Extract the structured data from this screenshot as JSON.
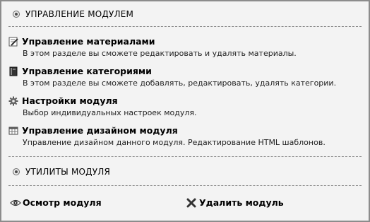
{
  "modules_section": {
    "header": "УПРАВЛЕНИЕ МОДУЛЕМ",
    "items": [
      {
        "title": "Управление материалами",
        "description": "В этом разделе вы сможете редактировать и удалять материалы.",
        "icon": "edit-document-icon"
      },
      {
        "title": "Управление категориями",
        "description": "В этом разделе вы сможете добавлять, редактировать, удалять категории.",
        "icon": "book-icon"
      },
      {
        "title": "Настройки модуля",
        "description": "Выбор индивидуальных настроек модуля.",
        "icon": "gear-icon"
      },
      {
        "title": "Управление дизайном модуля",
        "description": "Управление дизайном данного модуля. Редактирование HTML шаблонов.",
        "icon": "layout-grid-icon"
      }
    ]
  },
  "utilities_section": {
    "header": "УТИЛИТЫ МОДУЛЯ",
    "actions": [
      {
        "label": "Осмотр модуля",
        "icon": "eye-icon"
      },
      {
        "label": "Удалить модуль",
        "icon": "delete-x-icon"
      }
    ]
  }
}
